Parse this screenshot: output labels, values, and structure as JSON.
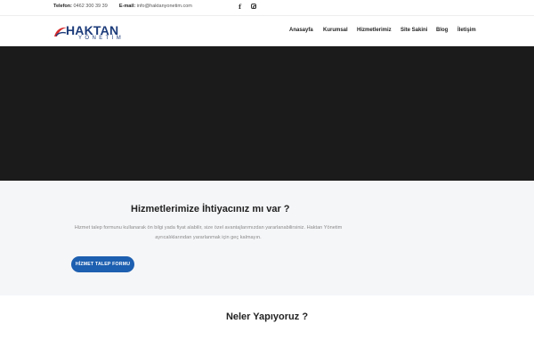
{
  "topbar": {
    "phone_label": "Telefon:",
    "phone_value": "0462 300 39 39",
    "email_label": "E-mail:",
    "email_value": "info@haktanyonetim.com",
    "social": [
      {
        "icon": "facebook-icon",
        "glyph": "f"
      },
      {
        "icon": "instagram-icon",
        "glyph": ""
      }
    ]
  },
  "logo": {
    "brand": "HAKTAN",
    "sub": "YÖNETİM",
    "colors": {
      "primary": "#1c3b7a",
      "accent": "#d62b2b"
    }
  },
  "nav": {
    "items": [
      {
        "label": "Anasayfa"
      },
      {
        "label": "Kurumsal"
      },
      {
        "label": "Hizmetlerimiz"
      },
      {
        "label": "Site Sakini"
      },
      {
        "label": "Blog"
      },
      {
        "label": "İletişim"
      }
    ]
  },
  "hero": {
    "background": "#1b1b1b"
  },
  "service_request": {
    "title": "Hizmetlerimize İhtiyacınız mı var ?",
    "description": "Hizmet talep formunu kullanarak ön bilgi yada fiyat alabilir, size özel avantajlarımızdan yararlanabilirsiniz. Haktan Yönetim ayrıcalıklarından yararlanmak için geç kalmayın.",
    "button_label": "HİZMET TALEP FORMU",
    "button_color": "#1d5fb0"
  },
  "what_we_do": {
    "title": "Neler Yapıyoruz ?"
  }
}
